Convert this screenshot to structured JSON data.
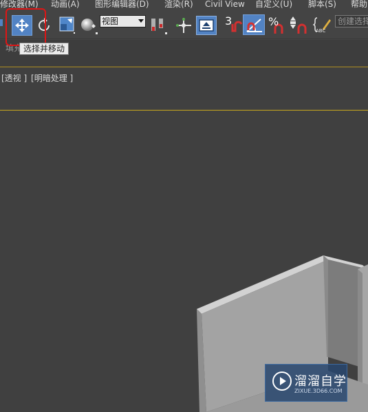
{
  "menubar": {
    "items": [
      {
        "label": "修改器(M)"
      },
      {
        "label": "动画(A)"
      },
      {
        "label": "图形编辑器(D)"
      },
      {
        "label": "渲染(R)"
      },
      {
        "label": "Civil View"
      },
      {
        "label": "自定义(U)"
      },
      {
        "label": "脚本(S)"
      },
      {
        "label": "帮助"
      }
    ]
  },
  "toolbar": {
    "reference_coord_value": "视图",
    "snap_number": "3",
    "percent_symbol": "%",
    "abc_text": "ABC",
    "create_selection_set_placeholder": "创建选择集"
  },
  "tooltip": {
    "text": "选择并移动"
  },
  "ribbon": {
    "tab_fragment": "填充"
  },
  "viewport": {
    "label_view": "[透视 ]",
    "label_shading": "[明暗处理 ]"
  },
  "watermark": {
    "title": "溜溜自学",
    "subtitle": "ZIXUE.3D66.COM"
  },
  "colors": {
    "background": "#444444",
    "viewport": "#404040",
    "active_tool": "#5283c4",
    "highlight": "#e01515",
    "horizon_line": "#c8a81e"
  }
}
